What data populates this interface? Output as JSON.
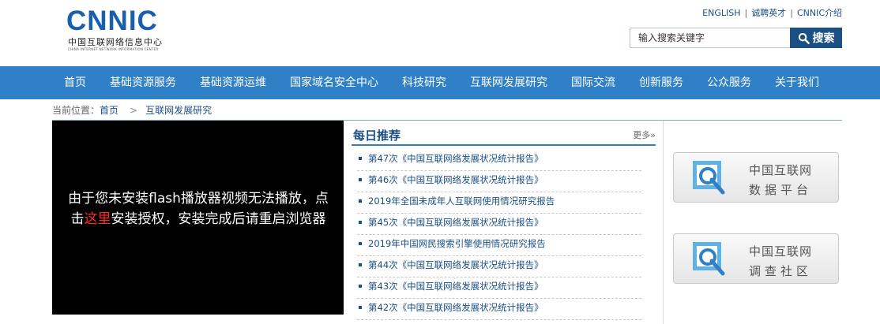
{
  "header": {
    "logo_text": "CNNIC",
    "logo_cn": "中国互联网络信息中心",
    "logo_en": "CHINA INTERNET NETWORK INFORMATION CENTER",
    "top_links": [
      "ENGLISH",
      "诚聘英才",
      "CNNIC介绍"
    ],
    "search_placeholder": "输入搜索关键字",
    "search_button": "搜索"
  },
  "nav": [
    "首页",
    "基础资源服务",
    "基础资源运维",
    "国家域名安全中心",
    "科技研究",
    "互联网发展研究",
    "国际交流",
    "创新服务",
    "公众服务",
    "关于我们"
  ],
  "breadcrumb": {
    "label": "当前位置：",
    "items": [
      "首页",
      "互联网发展研究"
    ],
    "separator": ">"
  },
  "video": {
    "msg_before": "由于您未安装flash播放器视频无法播放，点击",
    "msg_link": "这里",
    "msg_after": "安装授权，安装完成后请重启浏览器"
  },
  "daily": {
    "title": "每日推荐",
    "more": "更多»",
    "items": [
      "第47次《中国互联网络发展状况统计报告》",
      "第46次《中国互联网络发展状况统计报告》",
      "2019年全国未成年人互联网使用情况研究报告",
      "第45次《中国互联网络发展状况统计报告》",
      "2019年中国网民搜索引擎使用情况研究报告",
      "第44次《中国互联网络发展状况统计报告》",
      "第43次《中国互联网络发展状况统计报告》",
      "第42次《中国互联网络发展状况统计报告》"
    ]
  },
  "cards": [
    {
      "line1": "中国互联网",
      "line2": "数据平台"
    },
    {
      "line1": "中国互联网",
      "line2": "调查社区"
    }
  ],
  "colors": {
    "brand": "#1a5fae",
    "nav_bg": "#2f80c6",
    "link": "#1a4f86",
    "alert": "#ff2a2a"
  }
}
